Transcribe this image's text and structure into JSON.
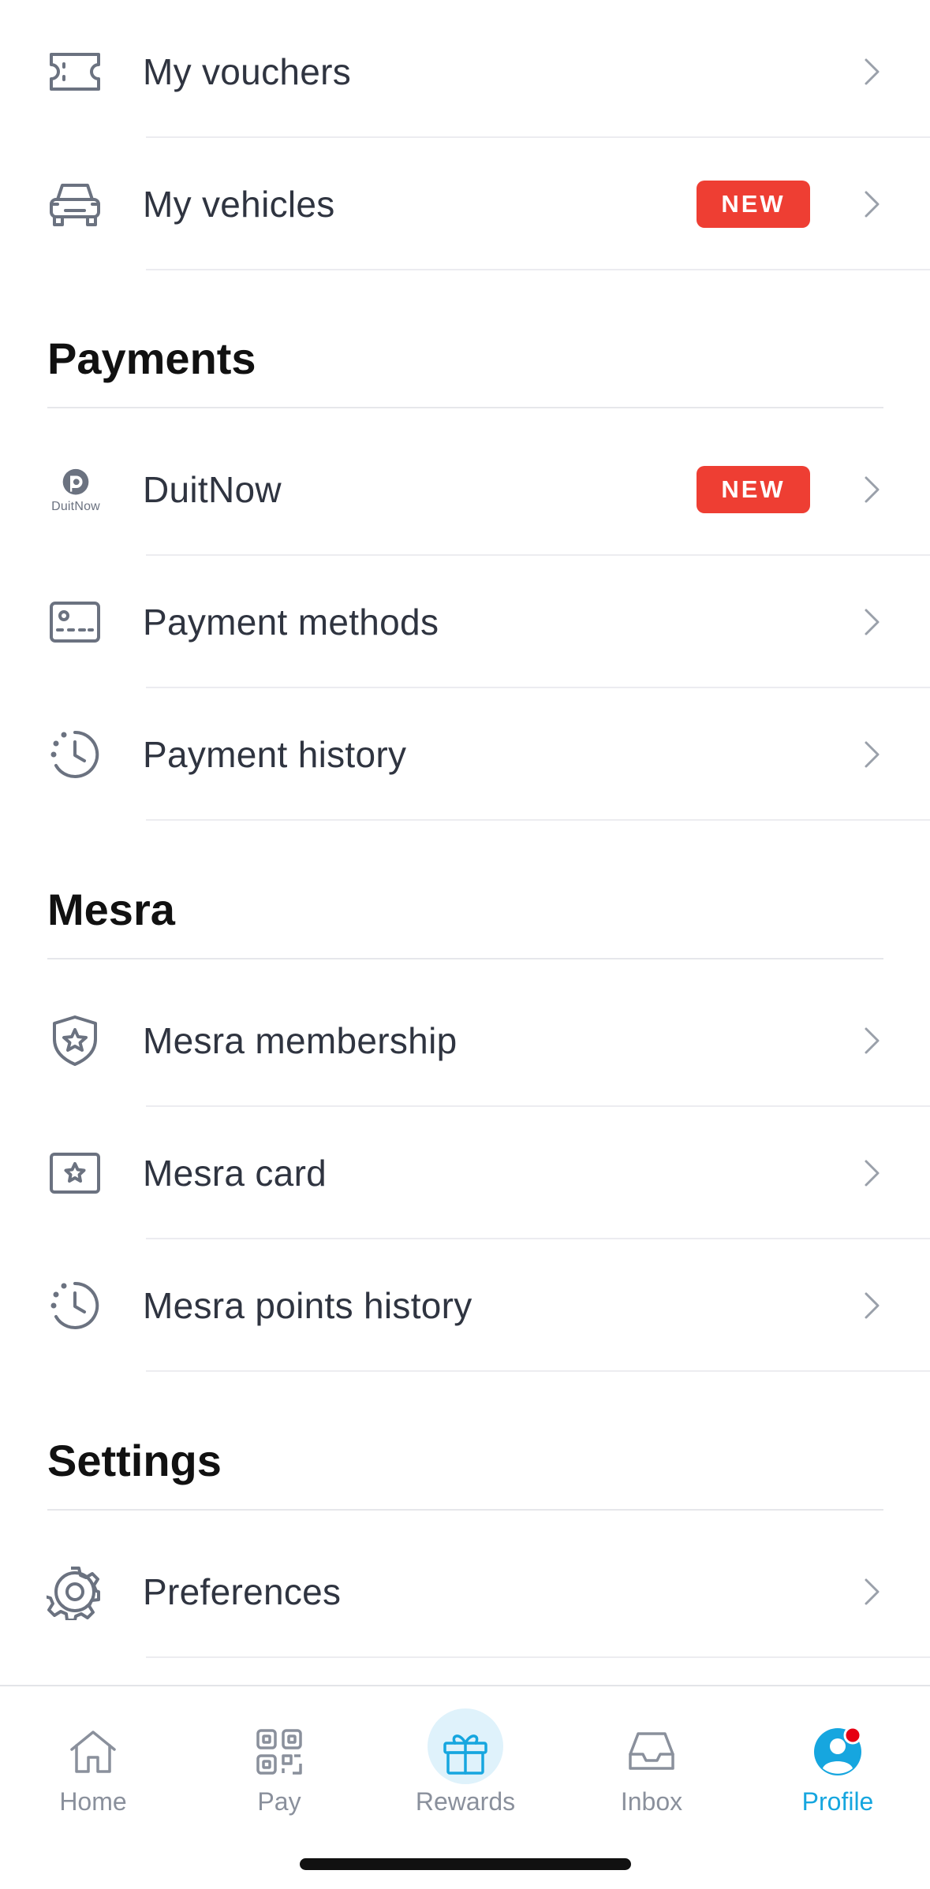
{
  "rows": {
    "vouchers": {
      "label": "My vouchers",
      "icon": "ticket-icon"
    },
    "vehicles": {
      "label": "My vehicles",
      "icon": "car-icon",
      "badge": "NEW"
    },
    "duitnow": {
      "label": "DuitNow",
      "icon": "duitnow-logo-icon",
      "logo_text": "DuitNow",
      "badge": "NEW"
    },
    "payment_methods": {
      "label": "Payment methods",
      "icon": "card-icon"
    },
    "payment_history": {
      "label": "Payment history",
      "icon": "history-icon"
    },
    "mesra_membership": {
      "label": "Mesra membership",
      "icon": "shield-star-icon"
    },
    "mesra_card": {
      "label": "Mesra card",
      "icon": "star-card-icon"
    },
    "mesra_points_history": {
      "label": "Mesra points history",
      "icon": "history-icon"
    },
    "preferences": {
      "label": "Preferences",
      "icon": "gear-icon"
    }
  },
  "sections": {
    "payments": "Payments",
    "mesra": "Mesra",
    "settings": "Settings"
  },
  "tabbar": {
    "home": {
      "label": "Home",
      "icon": "home-icon"
    },
    "pay": {
      "label": "Pay",
      "icon": "qr-icon"
    },
    "rewards": {
      "label": "Rewards",
      "icon": "gift-icon"
    },
    "inbox": {
      "label": "Inbox",
      "icon": "inbox-icon"
    },
    "profile": {
      "label": "Profile",
      "icon": "profile-icon",
      "active": true
    }
  },
  "colors": {
    "badge": "#ee3e33",
    "accent": "#16a6df",
    "icon_gray": "#6b7280",
    "notification_dot": "#e60012"
  }
}
